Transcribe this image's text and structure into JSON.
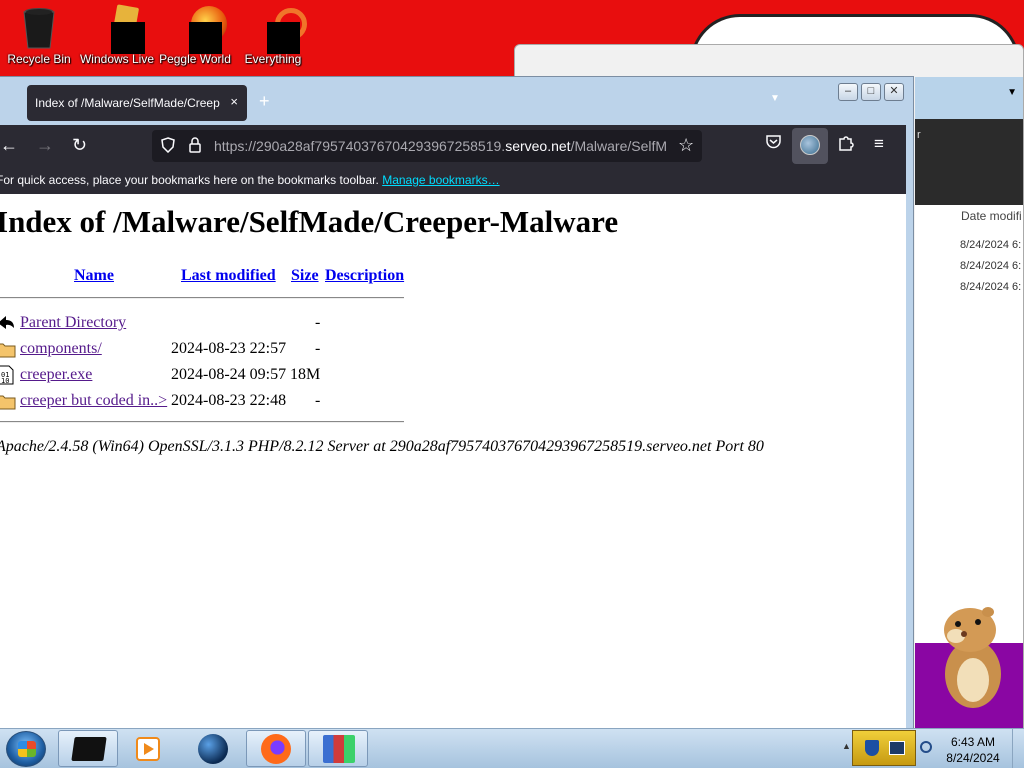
{
  "desktop": {
    "icons": [
      {
        "label": "Recycle Bin",
        "icon": "recycle-bin-icon"
      },
      {
        "label": "Windows Live",
        "icon": "windows-live-icon"
      },
      {
        "label": "Peggle World",
        "icon": "peggle-world-icon"
      },
      {
        "label": "Everything",
        "icon": "everything-search-icon"
      }
    ],
    "background_color": "#e80e0e"
  },
  "background_window": {
    "column_header": "Date modifi",
    "partial_title": "r",
    "dates": [
      "8/24/2024 6:",
      "8/24/2024 6:",
      "8/24/2024 6:"
    ]
  },
  "browser": {
    "tab": {
      "title": "Index of /Malware/SelfMade/Creeper-Malware",
      "close": "×"
    },
    "new_tab": "+",
    "url": {
      "prefix": "https://",
      "subdomain": "290a28af795740376704293967258519.",
      "domain": "serveo.net",
      "path": "/Malware/SelfMade/Creeper-Malware/"
    },
    "bookmarks_bar": {
      "text": "For quick access, place your bookmarks here on the bookmarks toolbar.",
      "link": "Manage bookmarks…"
    },
    "window_controls": [
      "minimize",
      "maximize",
      "close"
    ]
  },
  "page": {
    "heading": "Index of /Malware/SelfMade/Creeper-Malware",
    "columns": {
      "name": "Name",
      "modified": "Last modified",
      "size": "Size",
      "description": "Description"
    },
    "rows": [
      {
        "name": "Parent Directory",
        "modified": "",
        "size": "-",
        "icon": "back-arrow-icon"
      },
      {
        "name": "components/",
        "modified": "2024-08-23 22:57",
        "size": "-",
        "icon": "folder-icon"
      },
      {
        "name": "creeper.exe",
        "modified": "2024-08-24 09:57",
        "size": "18M",
        "icon": "binary-file-icon"
      },
      {
        "name": "creeper but coded in..>",
        "modified": "2024-08-23 22:48",
        "size": "-",
        "icon": "folder-icon"
      }
    ],
    "footer": "Apache/2.4.58 (Win64) OpenSSL/3.1.3 PHP/8.2.12 Server at 290a28af795740376704293967258519.serveo.net Port 80"
  },
  "taskbar": {
    "time": "6:43 AM",
    "date": "8/24/2024",
    "apps": [
      "black-app",
      "media-player",
      "globe-app",
      "firefox",
      "winrar"
    ]
  }
}
